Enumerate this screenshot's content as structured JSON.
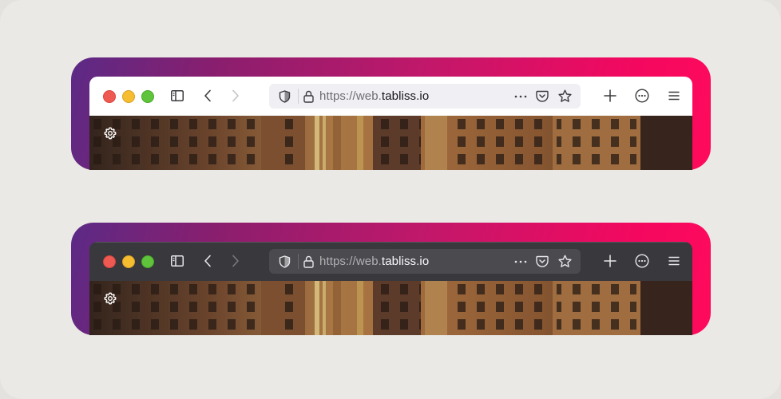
{
  "windows": [
    {
      "theme": "light",
      "url": {
        "scheme": "https://",
        "subdomain": "web.",
        "host": "tabliss.io"
      },
      "colors": {
        "icon": "#3a3a3f",
        "icon_disabled": "#c4c4c8"
      }
    },
    {
      "theme": "dark",
      "url": {
        "scheme": "https://",
        "subdomain": "web.",
        "host": "tabliss.io"
      },
      "colors": {
        "icon": "#e8e8ea",
        "icon_disabled": "#7a7a7f"
      }
    }
  ],
  "icons": {
    "traffic": [
      "close-icon",
      "minimize-icon",
      "maximize-icon"
    ],
    "toolbar": [
      "sidebar-icon",
      "back-icon",
      "forward-icon",
      "shield-icon",
      "lock-icon",
      "more-icon",
      "pocket-icon",
      "star-icon",
      "new-tab-icon",
      "extensions-icon",
      "menu-icon"
    ],
    "content": [
      "gear-icon"
    ]
  },
  "colors": {
    "frame_gradient_start": "#5b2a86",
    "frame_gradient_end": "#ff0a5c",
    "background": "#ebe9e6"
  }
}
